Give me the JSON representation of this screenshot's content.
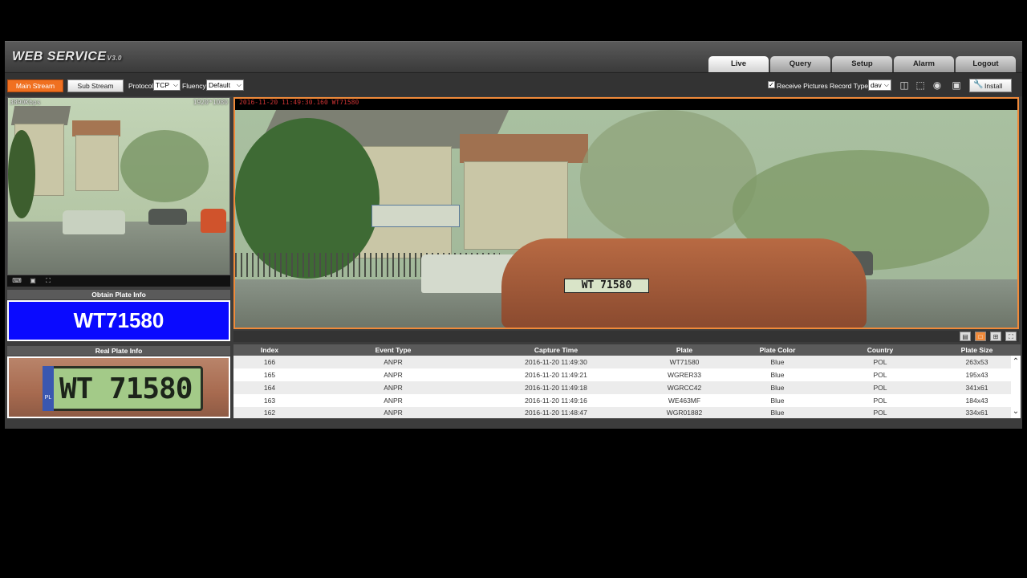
{
  "app": {
    "logo_text": "WEB SERVICE",
    "logo_version": "V3.0"
  },
  "tabs": [
    {
      "label": "Live",
      "active": true
    },
    {
      "label": "Query",
      "active": false
    },
    {
      "label": "Setup",
      "active": false
    },
    {
      "label": "Alarm",
      "active": false
    },
    {
      "label": "Logout",
      "active": false
    }
  ],
  "toolbar": {
    "main_stream": "Main Stream",
    "sub_stream": "Sub Stream",
    "protocol_label": "Protocol",
    "protocol_value": "TCP",
    "fluency_label": "Fluency",
    "fluency_value": "Default",
    "receive_pictures_label": "Receive Pictures",
    "receive_pictures_checked": true,
    "record_type_label": "Record Type",
    "record_type_value": "dav",
    "install_label": "Install"
  },
  "preview": {
    "bitrate": "3890Kbps",
    "resolution": "1920*1080"
  },
  "video": {
    "stamp": "2016-11-20 11:49:30.160 WT71580",
    "car_plate": "WT 71580"
  },
  "obtain_plate": {
    "title": "Obtain Plate Info",
    "plate": "WT71580"
  },
  "real_plate": {
    "title": "Real Plate Info",
    "plate_text": "WT 71580",
    "country_code": "PL"
  },
  "table": {
    "columns": [
      "Index",
      "Event Type",
      "Capture Time",
      "Plate",
      "Plate Color",
      "Country",
      "Plate Size"
    ],
    "rows": [
      [
        "166",
        "ANPR",
        "2016-11-20 11:49:30",
        "WT71580",
        "Blue",
        "POL",
        "263x53"
      ],
      [
        "165",
        "ANPR",
        "2016-11-20 11:49:21",
        "WGRER33",
        "Blue",
        "POL",
        "195x43"
      ],
      [
        "164",
        "ANPR",
        "2016-11-20 11:49:18",
        "WGRCC42",
        "Blue",
        "POL",
        "341x61"
      ],
      [
        "163",
        "ANPR",
        "2016-11-20 11:49:16",
        "WE463MF",
        "Blue",
        "POL",
        "184x43"
      ],
      [
        "162",
        "ANPR",
        "2016-11-20 11:48:47",
        "WGR01882",
        "Blue",
        "POL",
        "334x61"
      ]
    ]
  },
  "colors": {
    "accent": "#f07020",
    "plate_display_bg": "#0a0aff",
    "video_border": "#f08a3a"
  }
}
